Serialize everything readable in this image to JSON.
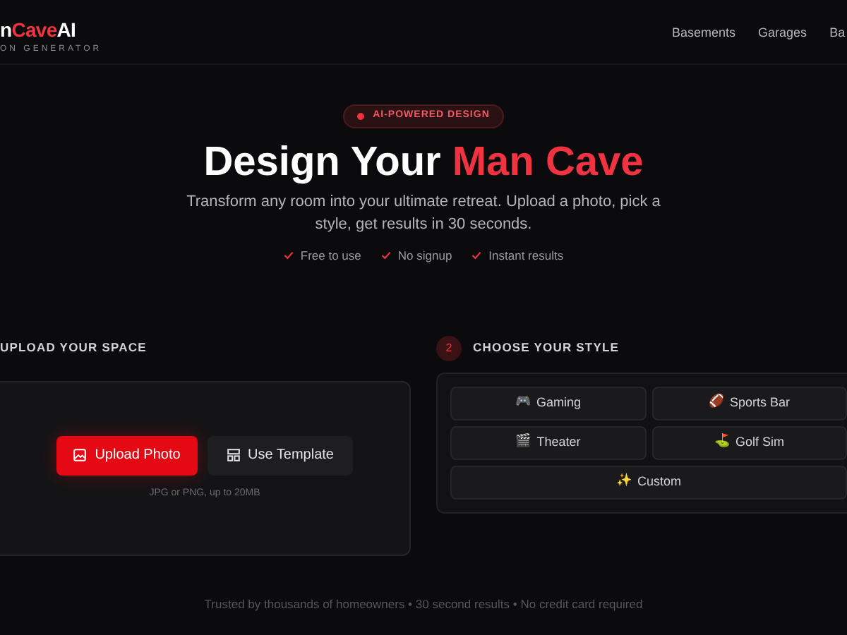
{
  "header": {
    "brand": [
      {
        "text": "n",
        "accent": false
      },
      {
        "text": "Cave",
        "accent": true
      },
      {
        "text": "AI",
        "accent": false
      }
    ],
    "tagline": "ON GENERATOR",
    "nav": [
      "Basements",
      "Garages",
      "Ba"
    ]
  },
  "hero": {
    "badge": "AI-POWERED DESIGN",
    "title": [
      {
        "text": "Design Your",
        "accent": false
      },
      {
        "text": "Man Cave",
        "accent": true
      }
    ],
    "subtitle": "Transform any room into your ultimate retreat. Upload a photo, pick a style, get results in 30 seconds.",
    "perks": [
      "Free to use",
      "No signup",
      "Instant results"
    ]
  },
  "upload": {
    "heading": "UPLOAD YOUR SPACE",
    "buttons": [
      {
        "label": "Upload Photo",
        "kind": "primary"
      },
      {
        "label": "Use Template",
        "kind": "secondary"
      }
    ],
    "hint": "JPG or PNG, up to 20MB"
  },
  "styles": {
    "step": "2",
    "heading": "CHOOSE YOUR STYLE",
    "options": [
      {
        "emoji": "🎮",
        "label": "Gaming"
      },
      {
        "emoji": "🏈",
        "label": "Sports Bar"
      },
      {
        "emoji": "🎬",
        "label": "Theater"
      },
      {
        "emoji": "⛳",
        "label": "Golf Sim"
      },
      {
        "emoji": "✨",
        "label": "Custom"
      }
    ]
  },
  "footer": "Trusted by thousands of homeowners • 30 second results • No credit card required"
}
